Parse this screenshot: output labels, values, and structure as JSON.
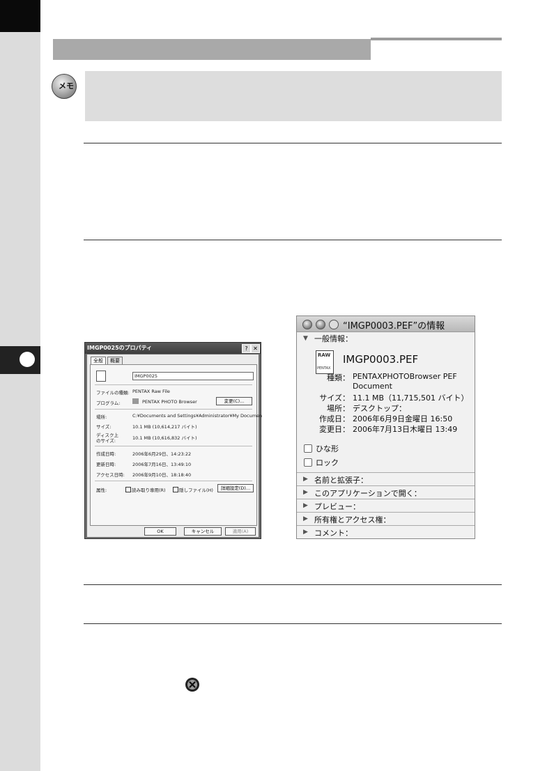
{
  "memo": {
    "icon_label": "メモ"
  },
  "windows_dialog": {
    "title": "IMGP0025のプロパティ",
    "help_button": "?",
    "close_button": "✕",
    "tabs": [
      "全般",
      "概要"
    ],
    "file_name": "IMGP0025",
    "rows": {
      "file_type_label": "ファイルの種類:",
      "file_type_value": "PENTAX Raw File",
      "program_label": "プログラム:",
      "program_value": "PENTAX PHOTO Browser",
      "change_button": "変更(C)...",
      "location_label": "場所:",
      "location_value": "C:¥Documents and Settings¥Administrator¥My Documen",
      "size_label": "サイズ:",
      "size_value": "10.1 MB (10,614,217 バイト)",
      "disk_size_label_1": "ディスク上",
      "disk_size_label_2": "のサイズ:",
      "disk_size_value": "10.1 MB (10,616,832 バイト)",
      "created_label": "作成日時:",
      "created_value": "2006年6月29日、14:23:22",
      "modified_label": "更新日時:",
      "modified_value": "2006年7月16日、13:49:10",
      "accessed_label": "アクセス日時:",
      "accessed_value": "2006年9月10日、18:18:40",
      "attributes_label": "属性:",
      "readonly_label": "読み取り専用(R)",
      "hidden_label": "隠しファイル(H)",
      "advanced_button": "詳細設定(D)..."
    },
    "ok_button": "OK",
    "cancel_button": "キャンセル",
    "apply_button": "適用(A)"
  },
  "mac_info": {
    "title": "“IMGP0003.PEF”の情報",
    "general_section": "一般情報：",
    "file_name": "IMGP0003.PEF",
    "raw_icon_label": "RAW",
    "raw_icon_brand": "PENTAX",
    "fields": [
      {
        "label": "種類：",
        "value": "PENTAXPHOTOBrowser PEF"
      },
      {
        "label": "",
        "value": "Document"
      },
      {
        "label": "サイズ：",
        "value": "11.1 MB（11,715,501 バイト）"
      },
      {
        "label": "場所：",
        "value": "デスクトップ："
      },
      {
        "label": "作成日：",
        "value": "2006年6月9日金曜日 16:50"
      },
      {
        "label": "変更日：",
        "value": "2006年7月13日木曜日 13:49"
      }
    ],
    "checkboxes": [
      "ひな形",
      "ロック"
    ],
    "sections": [
      "名前と拡張子：",
      "このアプリケーションで開く：",
      "プレビュー：",
      "所有権とアクセス権：",
      "コメント："
    ]
  }
}
